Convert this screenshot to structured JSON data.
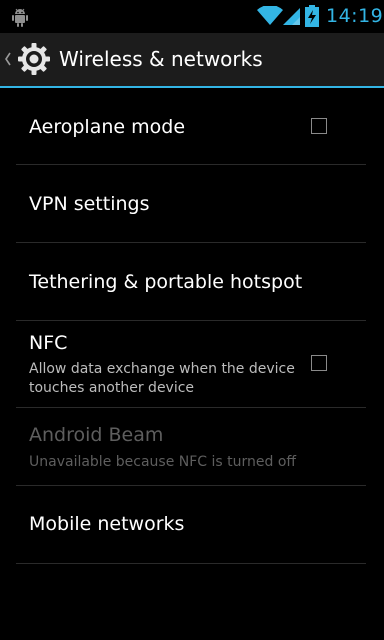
{
  "status_bar": {
    "time": "14:19",
    "icons": [
      "android-debug-icon",
      "wifi-icon",
      "signal-icon",
      "battery-charging-icon"
    ],
    "clock_color": "#33b5e5"
  },
  "action_bar": {
    "title": "Wireless & networks",
    "icon": "gear-icon",
    "accent_color": "#33b5e5"
  },
  "settings": [
    {
      "title": "Aeroplane mode",
      "checkbox": true,
      "checked": false,
      "enabled": true
    },
    {
      "title": "VPN settings",
      "enabled": true
    },
    {
      "title": "Tethering & portable hotspot",
      "enabled": true
    },
    {
      "title": "NFC",
      "summary": "Allow data exchange when the device touches another device",
      "checkbox": true,
      "checked": false,
      "enabled": true
    },
    {
      "title": "Android Beam",
      "summary": "Unavailable because NFC is turned off",
      "enabled": false
    },
    {
      "title": "Mobile networks",
      "enabled": true
    }
  ]
}
